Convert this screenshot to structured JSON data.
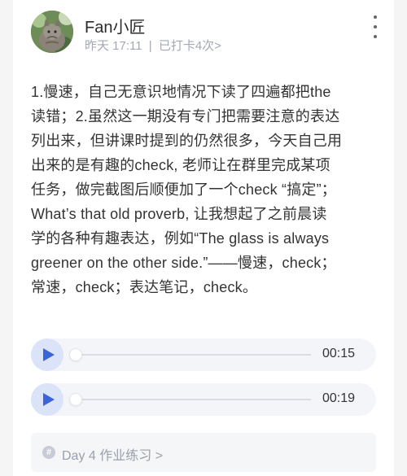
{
  "post": {
    "username": "Fan小匠",
    "time": "昨天 17:11",
    "separator": "|",
    "checkin": "已打卡4次>",
    "content": "1.慢速，自己无意识地情况下读了四遍都把the\n读错；2.虽然这一期没有专门把需要注意的表达\n列出来，但讲课时提到的仍然很多，今天自己用\n出来的是有趣的check, 老师让在群里完成某项\n任务，做完截图后顺便加了一个check “搞定”；\nWhat’s that old proverb, 让我想起了之前晨读\n学的各种有趣表达，例如“The glass is always\ngreener on the other side.”——慢速，check；\n常速，check；表达笔记，check。"
  },
  "audios": [
    {
      "duration": "00:15",
      "progress": 0
    },
    {
      "duration": "00:19",
      "progress": 0
    }
  ],
  "task": {
    "icon": "hash-icon",
    "label": "Day 4 作业练习 >"
  },
  "colors": {
    "accent": "#3a63d8",
    "play_bg": "#dbe3f9",
    "meta": "#a3a8b5"
  }
}
